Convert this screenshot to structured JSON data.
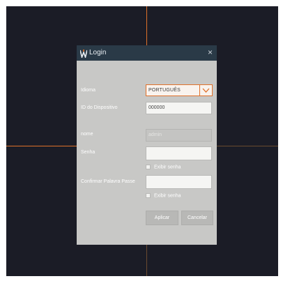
{
  "dialog": {
    "title": "Login",
    "close_glyph": "×",
    "logo_icon": "w-logo-icon",
    "fields": {
      "idioma_label": "Idioma",
      "idioma_value": "PORTUGUÊS",
      "device_id_label": "ID do Dispositivo",
      "device_id_value": "000000",
      "nome_label": "nome",
      "nome_value": "admin",
      "senha_label": "Senha",
      "senha_value": "",
      "show_pass_1": "Exibir senha",
      "confirm_label": "Confirmar Palavra Passe",
      "confirm_value": "",
      "show_pass_2": "Exibir senha"
    },
    "buttons": {
      "apply": "Aplicar",
      "cancel": "Cancelar"
    }
  },
  "colors": {
    "accent": "#e0712a",
    "titlebar": "#2a3a47",
    "panel": "#c8c8c6",
    "screen": "#1b1c26"
  }
}
